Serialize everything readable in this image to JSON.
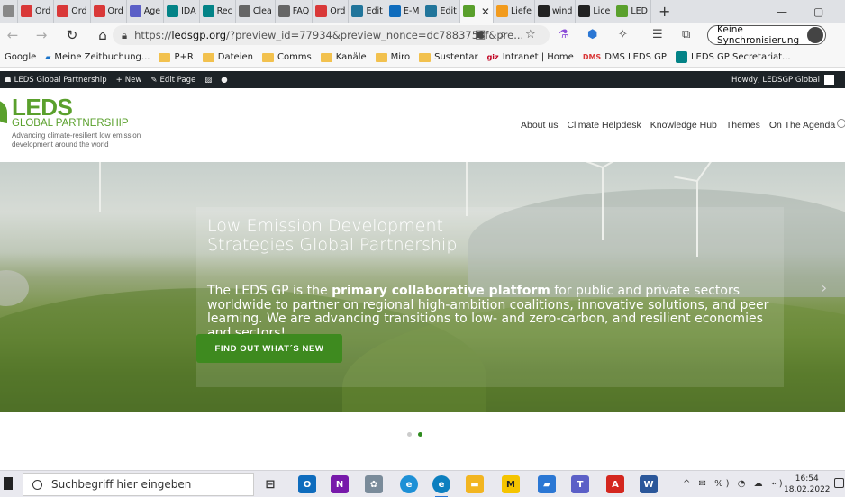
{
  "browser": {
    "tabs": [
      {
        "label": "",
        "icon": "tab-icon"
      },
      {
        "label": "Ord",
        "icon": "dms-icon",
        "color": "#d93838"
      },
      {
        "label": "Ord",
        "icon": "dms-icon",
        "color": "#d93838"
      },
      {
        "label": "Ord",
        "icon": "dms-icon",
        "color": "#d93838"
      },
      {
        "label": "Age",
        "icon": "teams-icon",
        "color": "#5b5fc7"
      },
      {
        "label": "IDA",
        "icon": "sharepoint-icon",
        "color": "#038387"
      },
      {
        "label": "Rec",
        "icon": "sharepoint-icon",
        "color": "#038387"
      },
      {
        "label": "Clea",
        "icon": "page-icon",
        "color": "#666666"
      },
      {
        "label": "FAQ",
        "icon": "page-icon",
        "color": "#666666"
      },
      {
        "label": "Ord",
        "icon": "dms-icon",
        "color": "#d93838"
      },
      {
        "label": "Edit",
        "icon": "wordpress-icon",
        "color": "#21759b"
      },
      {
        "label": "E-M",
        "icon": "outlook-icon",
        "color": "#0f6cbd"
      },
      {
        "label": "Edit",
        "icon": "wordpress-icon",
        "color": "#21759b"
      },
      {
        "label": "",
        "icon": "leds-icon",
        "color": "#5aa02c",
        "active": true
      },
      {
        "label": "Liefe",
        "icon": "home-icon",
        "color": "#f29b1d"
      },
      {
        "label": "wind",
        "icon": "windows-icon",
        "color": "#222222"
      },
      {
        "label": "Lice",
        "icon": "windows-icon",
        "color": "#222222"
      },
      {
        "label": "LED",
        "icon": "leds-icon",
        "color": "#5aa02c"
      }
    ],
    "tab_close": "✕",
    "new_tab": "+",
    "minimize": "—",
    "maximize": "▢",
    "url_prefix": "https://",
    "url_host": "ledsgp.org",
    "url_path": "/?preview_id=77934&preview_nonce=dc7883753f&pre...",
    "sync_label": "Keine Synchronisierung",
    "bookmarks": [
      {
        "label": "Google",
        "type": "text"
      },
      {
        "label": "Meine Zeitbuchung...",
        "type": "sap"
      },
      {
        "label": "P+R",
        "type": "folder"
      },
      {
        "label": "Dateien",
        "type": "folder"
      },
      {
        "label": "Comms",
        "type": "folder"
      },
      {
        "label": "Kanäle",
        "type": "folder"
      },
      {
        "label": "Miro",
        "type": "folder"
      },
      {
        "label": "Sustentar",
        "type": "folder"
      },
      {
        "label": "Intranet | Home",
        "type": "giz"
      },
      {
        "label": "DMS LEDS GP",
        "type": "dms"
      },
      {
        "label": "LEDS GP Secretariat...",
        "type": "sharepoint"
      }
    ],
    "bookmark_giz": "giz",
    "bookmark_dms": "DMS"
  },
  "wp_admin": {
    "site_name": "LEDS Global Partnership",
    "new_label": "New",
    "edit_label": "Edit Page",
    "howdy": "Howdy, LEDSGP Global"
  },
  "site": {
    "logo_title": "LEDS",
    "logo_subtitle": "GLOBAL PARTNERSHIP",
    "logo_tagline": "Advancing climate-resilient low emission development around the world",
    "nav": [
      "About us",
      "Climate Helpdesk",
      "Knowledge Hub",
      "Themes",
      "On The Agenda"
    ],
    "brand_color": "#5aa02c"
  },
  "hero": {
    "title": "Low Emission Development Strategies Global Partnership",
    "body_pre": "The LEDS GP is the ",
    "body_bold": "primary collaborative platform",
    "body_post": " for public and private sectors worldwide to partner on regional high-ambition coalitions, innovative solutions, and peer learning. We are advancing transitions to low- and zero-carbon, and resilient economies and sectors!",
    "cta": "FIND OUT WHAT´S NEW",
    "slide_count": 2,
    "active_slide": 2,
    "next_arrow": "›"
  },
  "taskbar": {
    "search_placeholder": "Suchbegriff hier eingeben",
    "tray": "^ ✉ %) ◔ ☁ ⌁)",
    "time": "16:54",
    "date": "18.02.2022"
  }
}
